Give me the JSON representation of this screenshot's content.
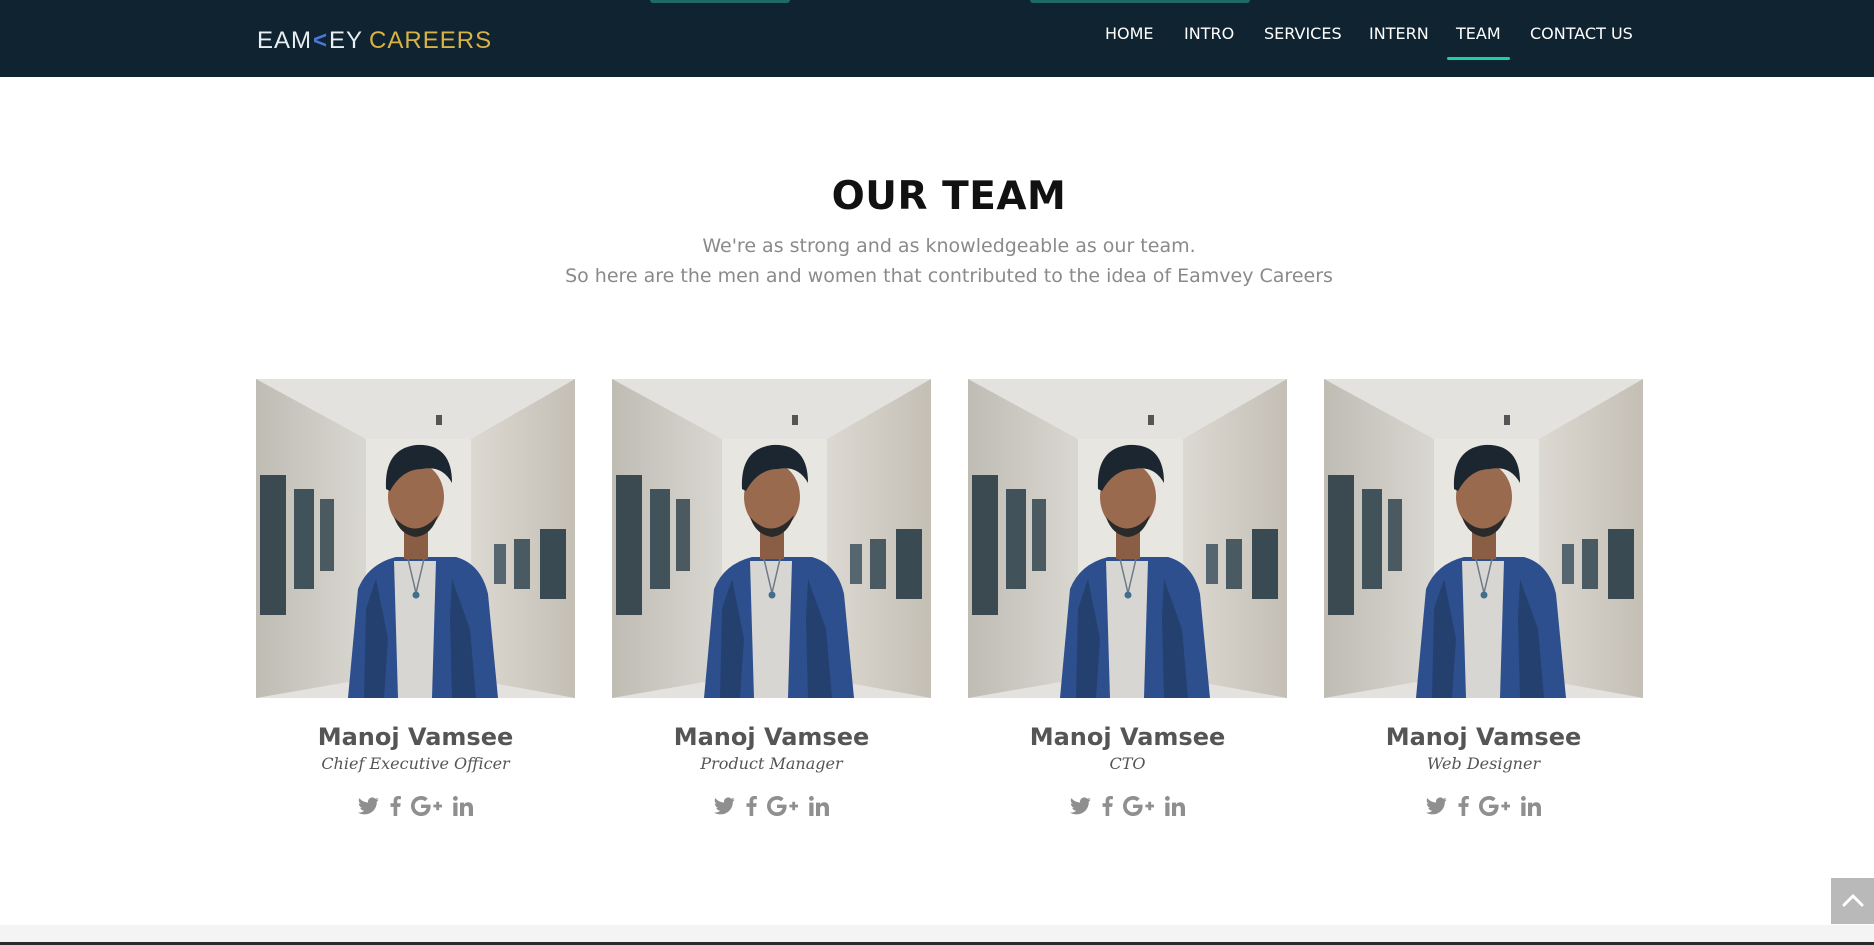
{
  "brand": {
    "logo_part1": "EA",
    "logo_mark": "M",
    "logo_chev": "<",
    "logo_part2": "EY",
    "logo_part3": "CAREERS"
  },
  "nav": {
    "items": [
      {
        "label": "HOME"
      },
      {
        "label": "INTRO"
      },
      {
        "label": "SERVICES"
      },
      {
        "label": "INTERN"
      },
      {
        "label": "TEAM",
        "active": true
      },
      {
        "label": "CONTACT US"
      }
    ]
  },
  "section": {
    "title": "OUR TEAM",
    "subtitle_line1": "We're as strong and as knowledgeable as our team.",
    "subtitle_line2": "So here are the men and women that contributed to the idea of Eamvey Careers"
  },
  "team": [
    {
      "name": "Manoj Vamsee",
      "role": "Chief Executive Officer"
    },
    {
      "name": "Manoj Vamsee",
      "role": "Product Manager"
    },
    {
      "name": "Manoj Vamsee",
      "role": "CTO"
    },
    {
      "name": "Manoj Vamsee",
      "role": "Web Designer"
    }
  ],
  "social_icons": [
    "twitter-icon",
    "facebook-icon",
    "google-plus-icon",
    "linkedin-icon"
  ],
  "colors": {
    "navbar_bg": "#0f2331",
    "accent": "#18d2a5",
    "logo_gold": "#d8b243",
    "text_gray": "#8a8a8a"
  }
}
